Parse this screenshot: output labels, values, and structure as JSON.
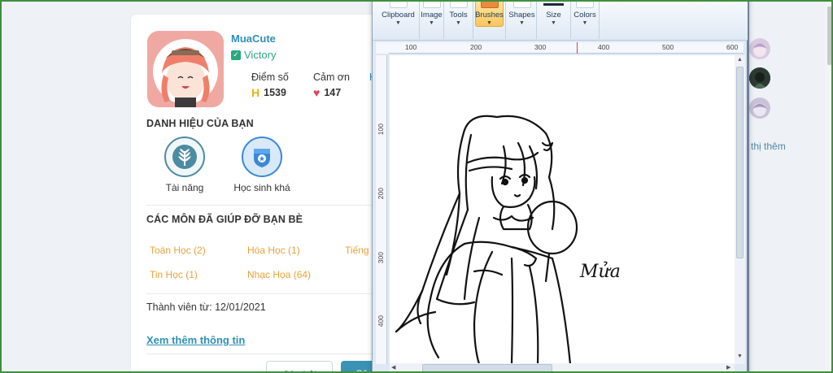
{
  "profile": {
    "username": "MuaCute",
    "rank": "Victory",
    "stats": {
      "points_label": "Điểm số",
      "points_value": "1539",
      "thanks_label": "Cảm ơn",
      "thanks_value": "147",
      "third_label_partial": "H"
    },
    "badges_title": "DANH HIỆU CỦA BẠN",
    "badges": [
      {
        "label": "Tài năng",
        "icon": "leaf-icon"
      },
      {
        "label": "Học sinh khá",
        "icon": "shield-star-icon"
      }
    ],
    "subjects_title": "CÁC MÔN ĐÃ GIÚP ĐỠ BẠN BÈ",
    "subjects": [
      "Toán Học (2)",
      "Hóa Học (1)",
      "Tiếng",
      "Tin Học (1)",
      "Nhạc Họa (64)"
    ],
    "member_since": "Thành viên từ: 12/01/2021",
    "more_info_link": "Xem thêm thông tin",
    "buttons": {
      "questions": "Câu hỏi",
      "answers_partial": "Câ"
    }
  },
  "sidebar": {
    "show_more": "n thị thêm"
  },
  "paint": {
    "ribbon": [
      "Clipboard",
      "Image",
      "Tools",
      "Brushes",
      "Shapes",
      "Size",
      "Colors"
    ],
    "active_tool": "Brushes",
    "ruler_h": [
      "100",
      "200",
      "300",
      "400",
      "500",
      "600"
    ],
    "ruler_v": [
      "100",
      "200",
      "300",
      "400"
    ],
    "signature": "Mửa"
  },
  "colors": {
    "accent_blue": "#2e8fb8",
    "rank_green": "#2aa87e",
    "subject_orange": "#e8a23a",
    "heart_red": "#e0455a",
    "button_blue": "#3a92b5"
  }
}
